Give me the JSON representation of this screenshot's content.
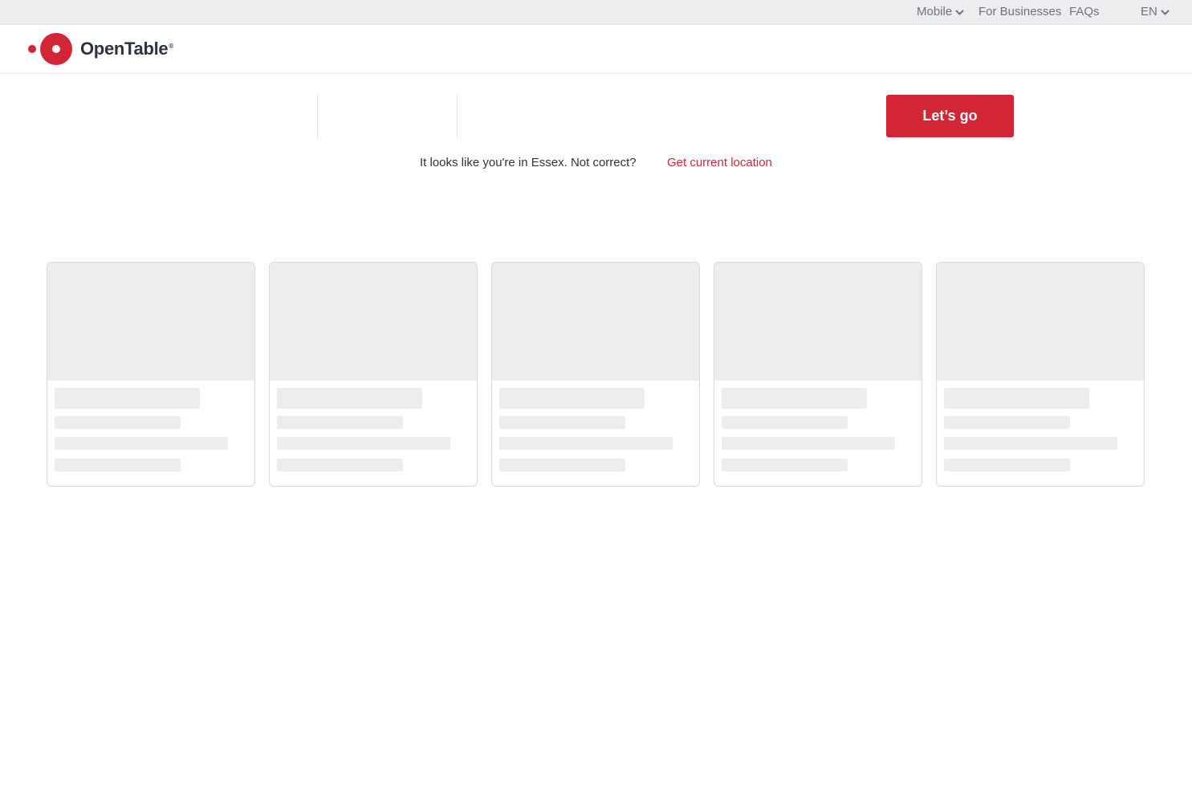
{
  "utility_nav": {
    "mobile": "Mobile",
    "for_businesses": "For Businesses",
    "faqs": "FAQs",
    "language": "EN"
  },
  "header": {
    "logo_text": "OpenTable",
    "logo_mark": "®"
  },
  "search": {
    "submit_label": "Let’s go"
  },
  "location": {
    "message": "It looks like you're in Essex. Not correct?",
    "link": "Get current location"
  },
  "colors": {
    "brand_red": "#d22636",
    "skeleton": "#ebedef",
    "utility_bar": "#ebedef"
  },
  "cards": [
    {
      "state": "loading"
    },
    {
      "state": "loading"
    },
    {
      "state": "loading"
    },
    {
      "state": "loading"
    },
    {
      "state": "loading"
    }
  ]
}
